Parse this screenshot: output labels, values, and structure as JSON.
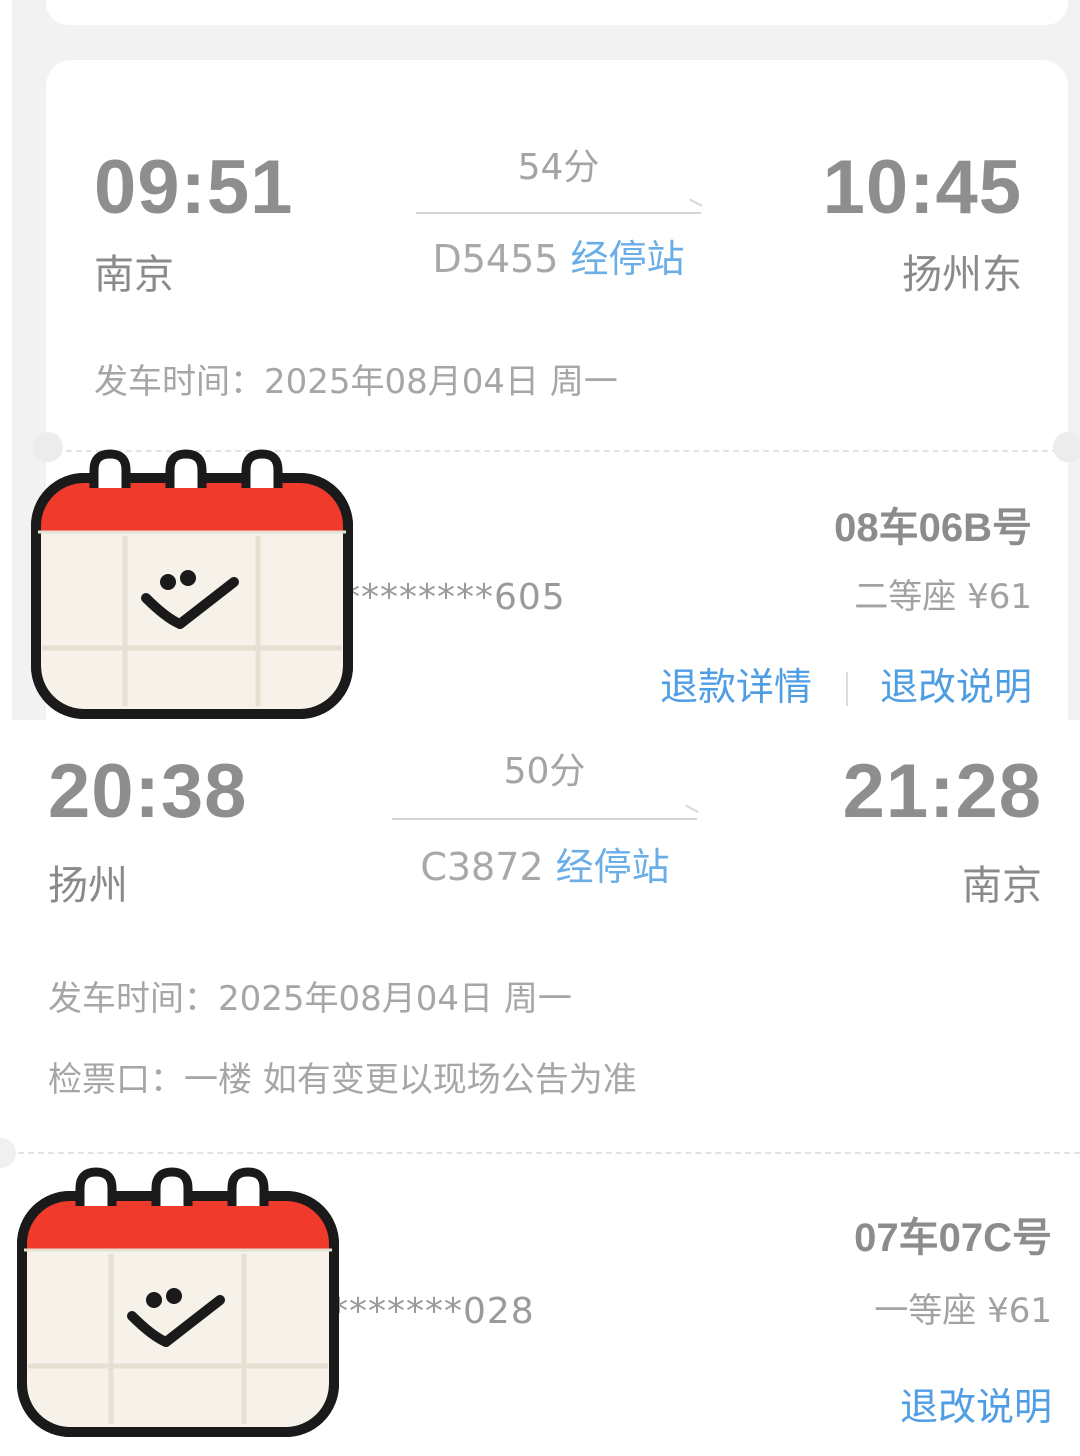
{
  "ticket1": {
    "depart_time": "09:51",
    "depart_station": "南京",
    "duration": "54分",
    "train_no": "D5455",
    "stops_link": "经停站",
    "arrive_time": "10:45",
    "arrive_station": "扬州东",
    "depart_date_line": "发车时间：2025年08月04日 周一",
    "masked_id": "********605",
    "seat_no": "08车06B号",
    "seat_class_price": "二等座 ¥61",
    "refund_detail_link": "退款详情",
    "change_rules_link": "退改说明"
  },
  "ticket2": {
    "depart_time": "20:38",
    "depart_station": "扬州",
    "duration": "50分",
    "train_no": "C3872",
    "stops_link": "经停站",
    "arrive_time": "21:28",
    "arrive_station": "南京",
    "depart_date_line": "发车时间：2025年08月04日 周一",
    "gate_line": "检票口：一楼  如有变更以现场公告为准",
    "masked_id": "*******028",
    "seat_no": "07车07C号",
    "seat_class_price": "一等座 ¥61",
    "change_rules_link": "退改说明"
  },
  "colors": {
    "link_blue": "#4f9de3",
    "stops_blue": "#6aaee8",
    "sticker_red": "#f03a2c",
    "sticker_paper": "#f6f2e9"
  },
  "icons": [
    "calendar-sticker-icon"
  ]
}
